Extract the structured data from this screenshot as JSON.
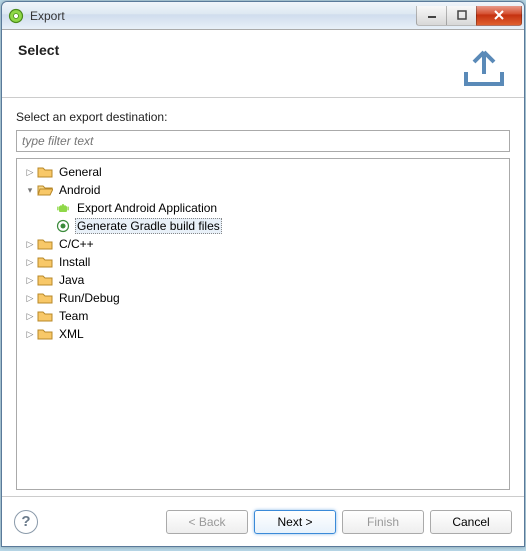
{
  "window": {
    "title": "Export"
  },
  "header": {
    "title": "Select"
  },
  "content": {
    "instruction": "Select an export destination:",
    "filter_placeholder": "type filter text",
    "selected_item": "Generate Gradle build files",
    "tree": {
      "general": "General",
      "android": "Android",
      "android_export_app": "Export Android Application",
      "android_gradle": "Generate Gradle build files",
      "cpp": "C/C++",
      "install": "Install",
      "java": "Java",
      "rundebug": "Run/Debug",
      "team": "Team",
      "xml": "XML"
    }
  },
  "footer": {
    "back": "< Back",
    "next": "Next >",
    "finish": "Finish",
    "cancel": "Cancel"
  }
}
